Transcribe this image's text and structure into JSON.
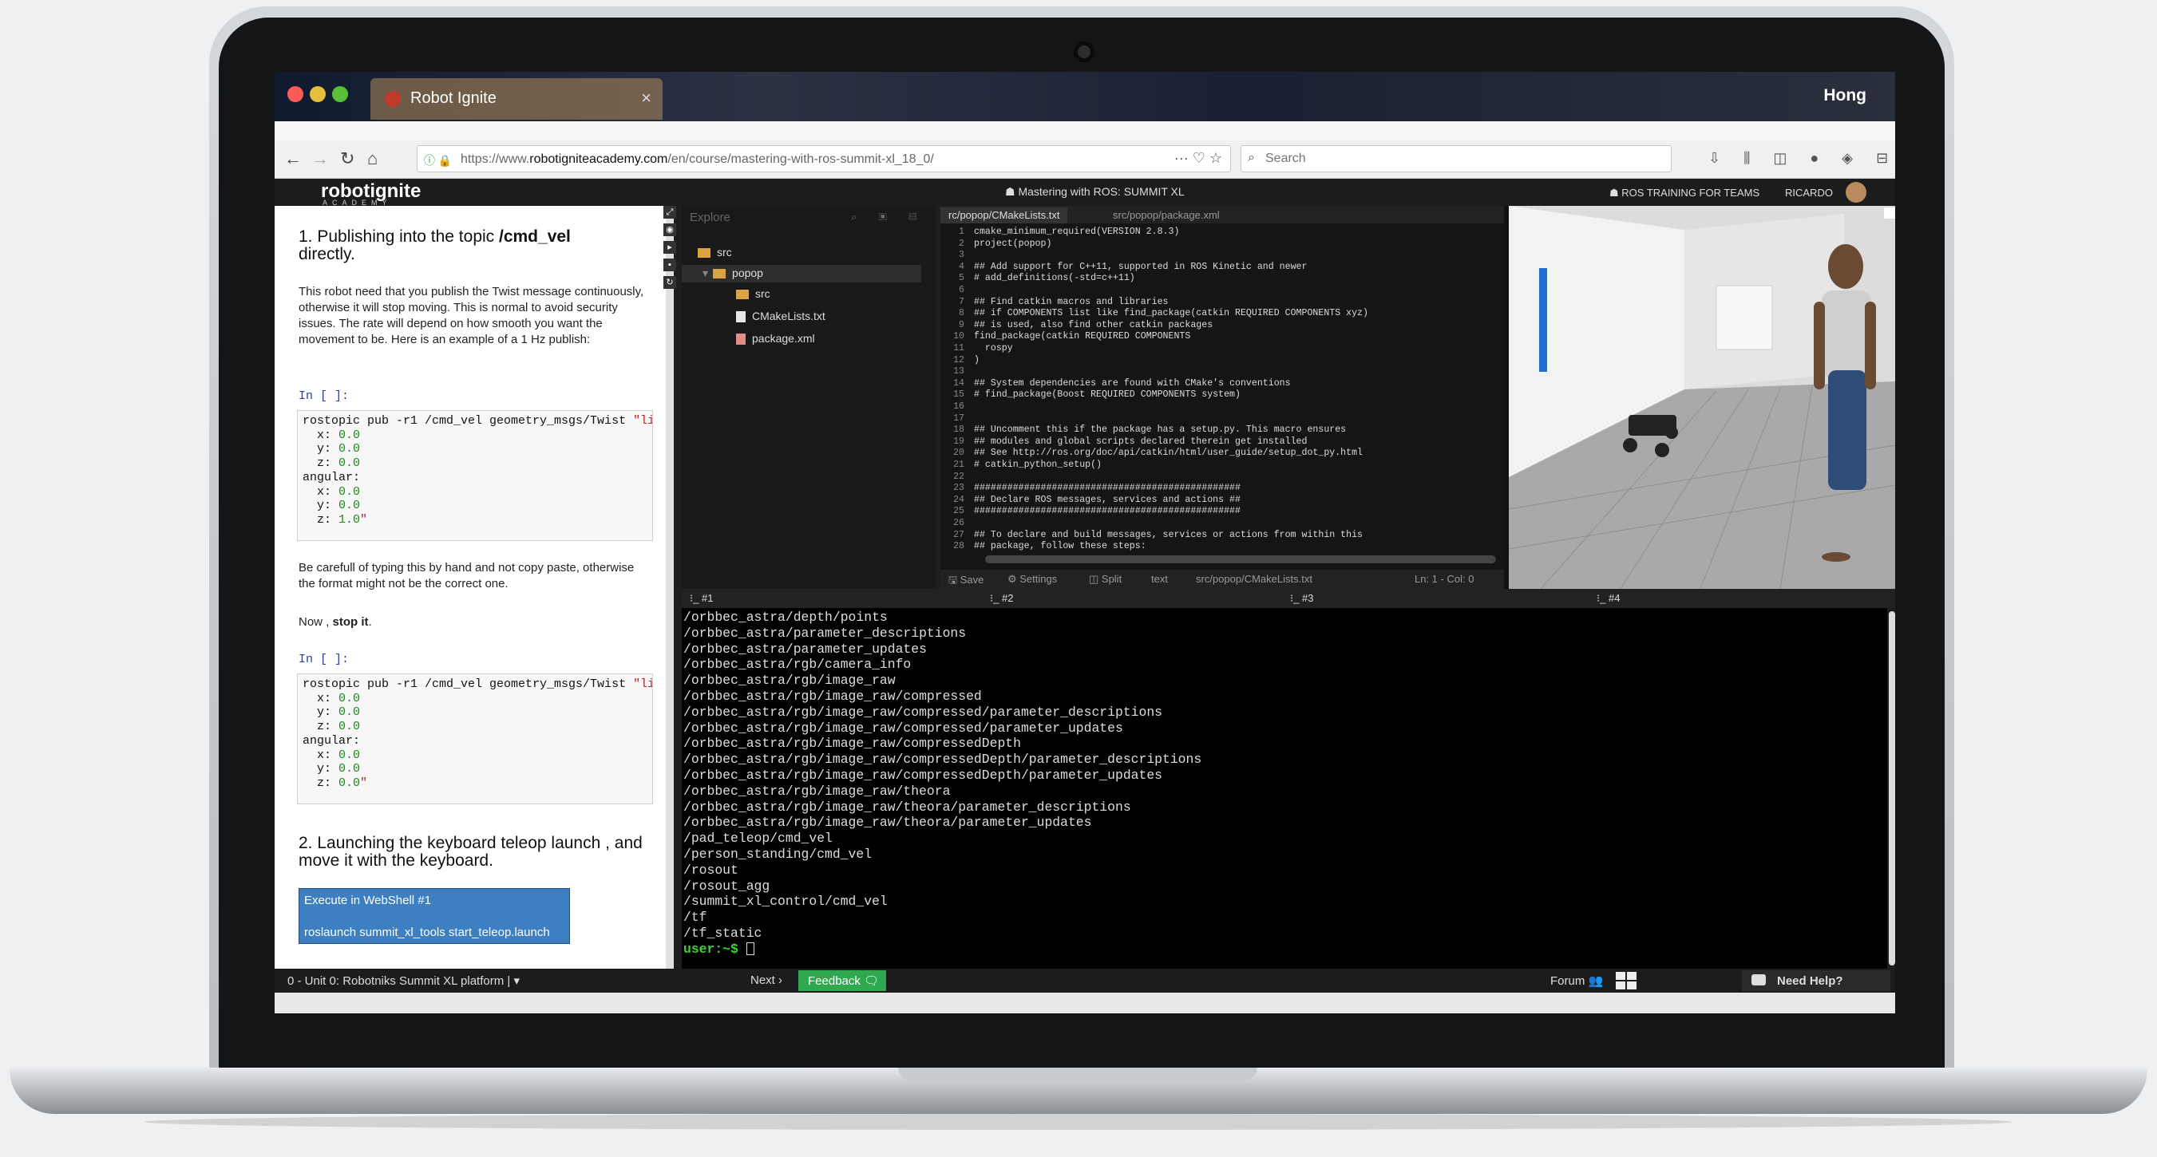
{
  "browser": {
    "tab_title": "Robot Ignite",
    "tab_close": "×",
    "user_name": "Hong",
    "url_prefix": "https://www.",
    "url_domain": "robotigniteacademy.com",
    "url_path": "/en/course/mastering-with-ros-summit-xl_18_0/",
    "url_icons": "··· ♡ ☆",
    "search_placeholder": "Search",
    "right_icons": "⇩ ⫼ ◫ ● ◈ ⊟ ≡",
    "back": "←",
    "forward": "→",
    "reload": "↻",
    "home": "⌂",
    "lock": "ⓘ 🔒"
  },
  "header": {
    "logo": "robotignite",
    "logo_sub": "ACADEMY",
    "course_title": "☗ Mastering with ROS: SUMMIT XL",
    "teams_link": "☗ ROS TRAINING FOR TEAMS",
    "account": "RICARDO"
  },
  "notebook": {
    "heading1_pre": "1. Publishing into the topic ",
    "heading1_bold": "/cmd_vel",
    "heading1_post": "directly.",
    "para1": "This robot need that you publish the Twist message continuously, otherwise it will stop moving. This is normal to avoid security issues. The rate will depend on how smooth you want the movement to be. Here is an example of a 1 Hz publish:",
    "prompt1": "In [ ]:",
    "prompt2": "In [ ]:",
    "para2": "Be carefull of typing this by hand and not copy paste, otherwise the format might not be the correct one.",
    "para3_pre": "Now , ",
    "para3_bold": "stop it",
    "para3_post": ".",
    "heading2": "2. Launching the keyboard teleop launch , and move it with the keyboard.",
    "exec_title": "Execute in WebShell #1",
    "exec_cmd": "roslaunch summit_xl_tools start_teleop.launch"
  },
  "explorer": {
    "title": "Explore",
    "icons": "⌕ ▣ ▤",
    "items": [
      "src",
      "popop",
      "src",
      "CMakeLists.txt",
      "package.xml"
    ]
  },
  "editor": {
    "tab_active": "rc/popop/CMakeLists.txt",
    "tab_inactive": "src/popop/package.xml",
    "lines": [
      "cmake_minimum_required(VERSION 2.8.3)",
      "project(popop)",
      "",
      "## Add support for C++11, supported in ROS Kinetic and newer",
      "# add_definitions(-std=c++11)",
      "",
      "## Find catkin macros and libraries",
      "## if COMPONENTS list like find_package(catkin REQUIRED COMPONENTS xyz)",
      "## is used, also find other catkin packages",
      "find_package(catkin REQUIRED COMPONENTS",
      "  rospy",
      ")",
      "",
      "## System dependencies are found with CMake's conventions",
      "# find_package(Boost REQUIRED COMPONENTS system)",
      "",
      "",
      "## Uncomment this if the package has a setup.py. This macro ensures",
      "## modules and global scripts declared therein get installed",
      "## See http://ros.org/doc/api/catkin/html/user_guide/setup_dot_py.html",
      "# catkin_python_setup()",
      "",
      "################################################",
      "## Declare ROS messages, services and actions ##",
      "################################################",
      "",
      "## To declare and build messages, services or actions from within this",
      "## package, follow these steps:"
    ],
    "status_save": "🖫 Save",
    "status_settings": "⚙ Settings",
    "status_split": "◫ Split",
    "status_mode": "text",
    "status_path": "src/popop/CMakeLists.txt",
    "status_pos": "Ln: 1 - Col: 0"
  },
  "shells": [
    "⁝_ #1",
    "⁝_ #2",
    "⁝_ #3",
    "⁝_ #4"
  ],
  "terminal": {
    "lines": [
      "/orbbec_astra/depth/points",
      "/orbbec_astra/parameter_descriptions",
      "/orbbec_astra/parameter_updates",
      "/orbbec_astra/rgb/camera_info",
      "/orbbec_astra/rgb/image_raw",
      "/orbbec_astra/rgb/image_raw/compressed",
      "/orbbec_astra/rgb/image_raw/compressed/parameter_descriptions",
      "/orbbec_astra/rgb/image_raw/compressed/parameter_updates",
      "/orbbec_astra/rgb/image_raw/compressedDepth",
      "/orbbec_astra/rgb/image_raw/compressedDepth/parameter_descriptions",
      "/orbbec_astra/rgb/image_raw/compressedDepth/parameter_updates",
      "/orbbec_astra/rgb/image_raw/theora",
      "/orbbec_astra/rgb/image_raw/theora/parameter_descriptions",
      "/orbbec_astra/rgb/image_raw/theora/parameter_updates",
      "/pad_teleop/cmd_vel",
      "/person_standing/cmd_vel",
      "/rosout",
      "/rosout_agg",
      "/summit_xl_control/cmd_vel",
      "/tf",
      "/tf_static"
    ],
    "prompt": "user:~$ "
  },
  "footer": {
    "unit": "0 - Unit 0: Robotniks Summit XL platform | ▾",
    "next": "Next ›",
    "feedback": "Feedback 🗨",
    "forum": "Forum 👥",
    "help": "Need Help?"
  }
}
